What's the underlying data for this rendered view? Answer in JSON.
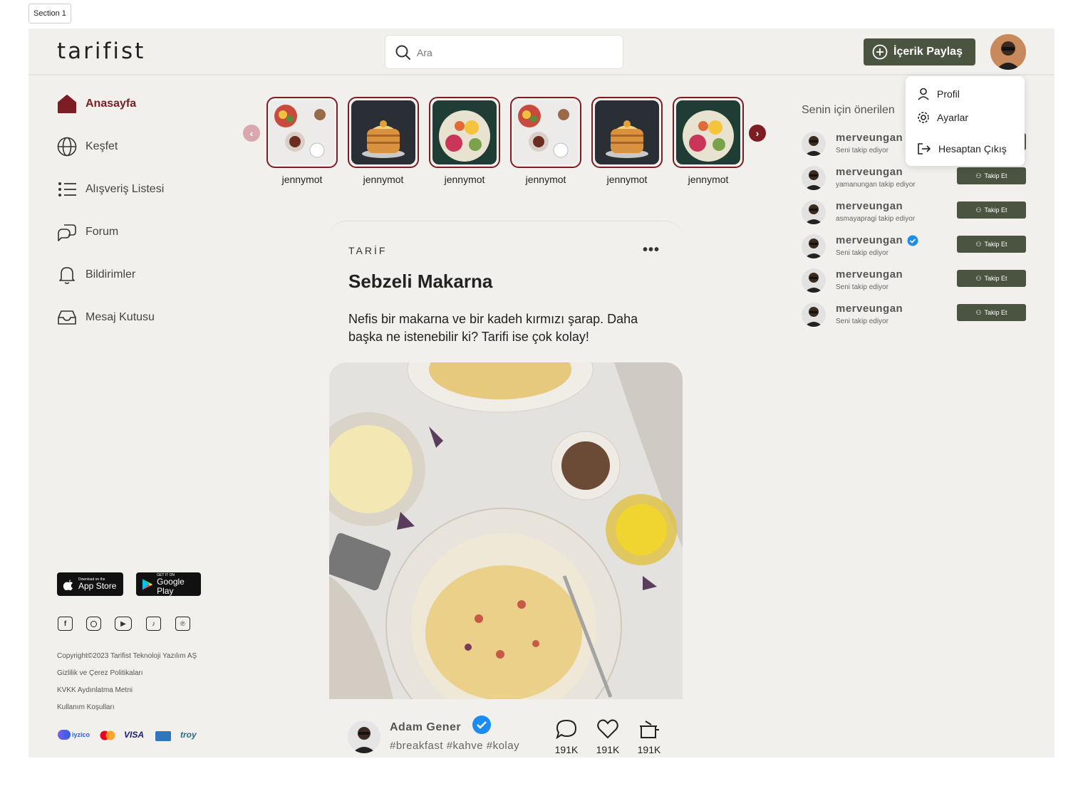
{
  "section_label": "Section 1",
  "header": {
    "logo": "tarifist",
    "search_placeholder": "Ara",
    "share_label": "İçerik Paylaş"
  },
  "dropdown": {
    "items": [
      "Profil",
      "Ayarlar",
      "Hesaptan Çıkış"
    ]
  },
  "sidebar": {
    "items": [
      {
        "label": "Anasayfa",
        "icon": "home-icon",
        "active": true
      },
      {
        "label": "Keşfet",
        "icon": "globe-icon"
      },
      {
        "label": "Alışveriş Listesi",
        "icon": "list-icon"
      },
      {
        "label": "Forum",
        "icon": "chat-bubbles-icon"
      },
      {
        "label": "Bildirimler",
        "icon": "bell-icon"
      },
      {
        "label": "Mesaj Kutusu",
        "icon": "inbox-icon"
      }
    ],
    "app_store": {
      "small": "Download on the",
      "big": "App Store"
    },
    "google_play": {
      "small": "GET IT ON",
      "big": "Google Play"
    },
    "social_icons": [
      "facebook-icon",
      "instagram-icon",
      "youtube-icon",
      "tiktok-icon",
      "pinterest-icon"
    ],
    "footer_links": [
      "Copyright©2023 Tarifist Teknoloji Yazılım AŞ",
      "Gizlilik ve Çerez Politikaları",
      "KVKK Aydınlatma Metni",
      "Kullanım Koşulları"
    ],
    "payments": [
      "iyzico",
      "mastercard",
      "VISA",
      "amex",
      "troy"
    ]
  },
  "stories": [
    {
      "name": "jennymot",
      "img": "breakfast"
    },
    {
      "name": "jennymot",
      "img": "pancakes"
    },
    {
      "name": "jennymot",
      "img": "salad"
    },
    {
      "name": "jennymot",
      "img": "breakfast"
    },
    {
      "name": "jennymot",
      "img": "pancakes"
    },
    {
      "name": "jennymot",
      "img": "salad"
    }
  ],
  "post": {
    "type": "TARİF",
    "more": "•••",
    "title": "Sebzeli Makarna",
    "description": "Nefis bir makarna ve bir kadeh kırmızı şarap. Daha başka ne istenebilir ki? Tarifi ise çok kolay!",
    "author": "Adam Gener",
    "tags": "#breakfast #kahve #kolay",
    "comments": "191K",
    "likes": "191K",
    "saves": "191K"
  },
  "suggestions": {
    "title": "Senin için önerilen",
    "follow_label": "Takip Et",
    "items": [
      {
        "name": "merveungan",
        "sub": "Seni takip ediyor",
        "verified": false
      },
      {
        "name": "merveungan",
        "sub": "yamanungan takip ediyor",
        "verified": false
      },
      {
        "name": "merveungan",
        "sub": "asmayapragi takip ediyor",
        "verified": false
      },
      {
        "name": "merveungan",
        "sub": "Seni takip ediyor",
        "verified": true
      },
      {
        "name": "merveungan",
        "sub": "Seni takip ediyor",
        "verified": false
      },
      {
        "name": "merveungan",
        "sub": "Seni takip ediyor",
        "verified": false
      }
    ]
  },
  "colors": {
    "accent": "#7c1d24",
    "button": "#4a5440",
    "background": "#f1f0ec"
  }
}
